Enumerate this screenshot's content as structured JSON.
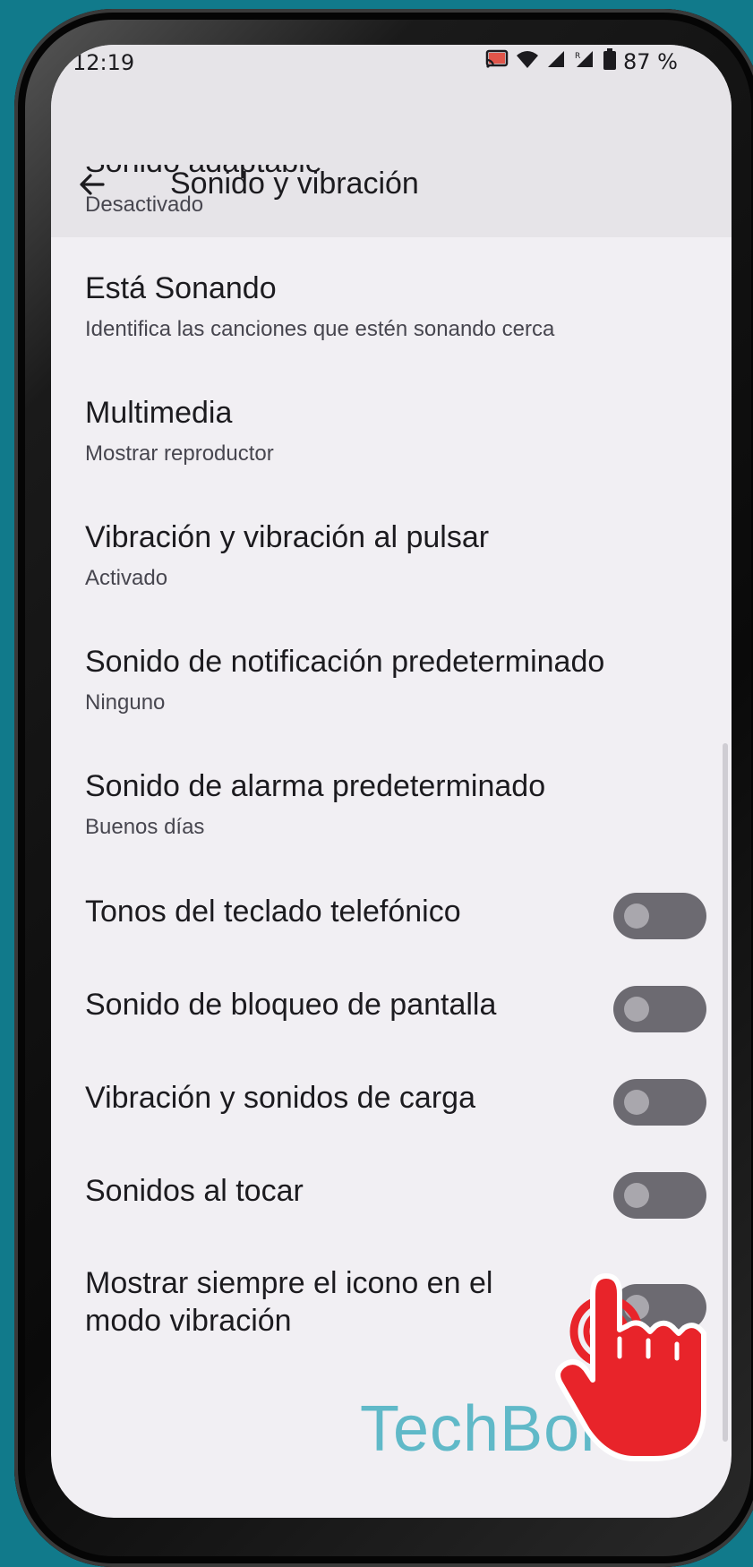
{
  "status_bar": {
    "time": "12:19",
    "battery": "87 %",
    "icons": [
      "cast-icon",
      "wifi-icon",
      "signal-icon",
      "signal-roaming-icon",
      "battery-icon"
    ]
  },
  "app_bar": {
    "title": "Sonido y vibración",
    "back_icon": "arrow-back-icon"
  },
  "settings": {
    "partial_item": {
      "title": "Sonido adaptable",
      "subtitle": "Desactivado"
    },
    "items": [
      {
        "title": "Está Sonando",
        "subtitle": "Identifica las canciones que estén sonando cerca"
      },
      {
        "title": "Multimedia",
        "subtitle": "Mostrar reproductor"
      },
      {
        "title": "Vibración y vibración al pulsar",
        "subtitle": "Activado"
      },
      {
        "title": "Sonido de notificación predeterminado",
        "subtitle": "Ninguno"
      },
      {
        "title": "Sonido de alarma predeterminado",
        "subtitle": "Buenos días"
      }
    ],
    "toggles": [
      {
        "title": "Tonos del teclado telefónico",
        "enabled": false
      },
      {
        "title": "Sonido de bloqueo de pantalla",
        "enabled": false
      },
      {
        "title": "Vibración y sonidos de carga",
        "enabled": false
      },
      {
        "title": "Sonidos al tocar",
        "enabled": false
      },
      {
        "title_line1": "Mostrar siempre el icono en el",
        "title_line2": "modo vibración",
        "enabled": false
      }
    ]
  },
  "watermark": "TechBone",
  "colors": {
    "background": "#117a8b",
    "screen": "#f1eff3",
    "app_bar": "#e6e4e8",
    "toggle_track_off": "#6c6a71",
    "toggle_knob_off": "#a9a7ad",
    "tap_indicator": "#e8242a",
    "watermark": "#60b9c8"
  }
}
